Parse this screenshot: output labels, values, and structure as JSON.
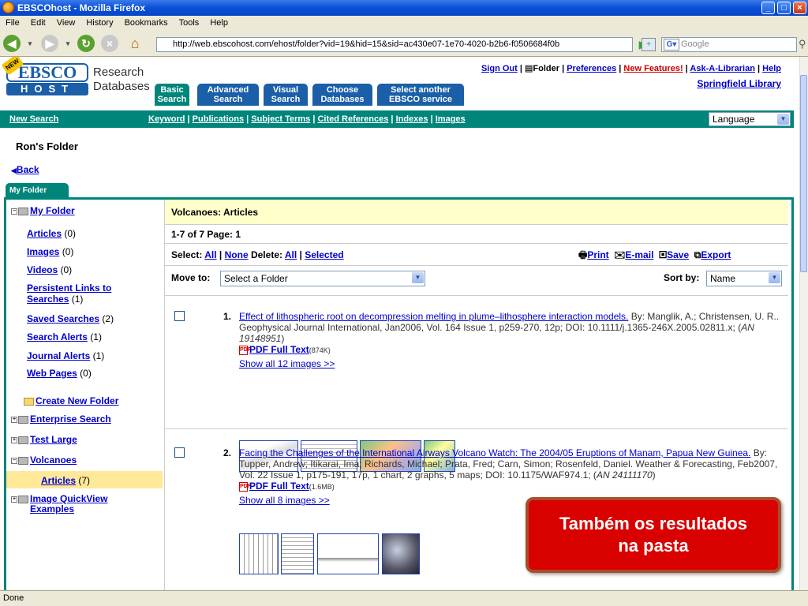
{
  "window": {
    "title": "EBSCOhost - Mozilla Firefox"
  },
  "menu": [
    "File",
    "Edit",
    "View",
    "History",
    "Bookmarks",
    "Tools",
    "Help"
  ],
  "address": {
    "url": "http://web.ebscohost.com/ehost/folder?vid=19&hid=15&sid=ac430e07-1e70-4020-b2b6-f0506684f0b",
    "search_placeholder": "Google"
  },
  "status": "Done",
  "ebsco": {
    "logo_top": "EBSCO",
    "logo_bottom": "HOST",
    "logo_badge": "NEW",
    "research": "Research",
    "databases": "Databases",
    "tabs": [
      {
        "l1": "Basic",
        "l2": "Search"
      },
      {
        "l1": "Advanced",
        "l2": "Search"
      },
      {
        "l1": "Visual",
        "l2": "Search"
      },
      {
        "l1": "Choose",
        "l2": "Databases"
      },
      {
        "l1": "Select another",
        "l2": "EBSCO service"
      }
    ],
    "toplinks": {
      "signout": "Sign Out",
      "folder": "Folder",
      "preferences": "Preferences",
      "new_features": "New Features!",
      "ask": "Ask-A-Librarian",
      "help": "Help"
    },
    "library": "Springfield Library",
    "secnav": {
      "new_search": "New Search",
      "keyword": "Keyword",
      "publications": "Publications",
      "subject_terms": "Subject Terms",
      "cited_refs": "Cited References",
      "indexes": "Indexes",
      "images": "Images"
    },
    "language": "Language"
  },
  "folder": {
    "title": "Ron's Folder",
    "back": "Back",
    "tab": "My Folder",
    "tree": {
      "my_folder": "My Folder",
      "articles": "Articles",
      "articles_count": "(0)",
      "images": "Images",
      "images_count": "(0)",
      "videos": "Videos",
      "videos_count": "(0)",
      "persistent": "Persistent Links to",
      "persistent2": "Searches",
      "persistent_count": "(1)",
      "saved": "Saved Searches",
      "saved_count": "(2)",
      "search_alerts": "Search Alerts",
      "search_alerts_count": "(1)",
      "journal_alerts": "Journal Alerts",
      "journal_alerts_count": "(1)",
      "web_pages": "Web Pages",
      "web_pages_count": "(0)",
      "create": "Create New Folder",
      "enterprise": "Enterprise Search",
      "test_large": "Test Large",
      "volcanoes": "Volcanoes",
      "vol_articles": "Articles",
      "vol_articles_count": "(7)",
      "image_quickview": "Image QuickView",
      "image_quickview2": "Examples"
    }
  },
  "results": {
    "heading": "Volcanoes: Articles",
    "count": "1-7 of 7  Page: 1",
    "select_label": "Select:",
    "all": "All",
    "none": "None",
    "delete_label": "Delete:",
    "del_all": "All",
    "del_selected": "Selected",
    "print": "Print",
    "email": "E-mail",
    "save": "Save",
    "export": "Export",
    "move_to": "Move to:",
    "move_value": "Select a Folder",
    "sort_by": "Sort by:",
    "sort_value": "Name",
    "items": [
      {
        "num": "1.",
        "title": "Effect of lithospheric root on decompression melting in plume–lithosphere interaction models.",
        "details1": " By: Manglik, A.; Christensen, U. R.. Geophysical Journal International, Jan2006, Vol. 164 Issue 1, p259-270, 12p; DOI: 10.1111/j.1365-246X.2005.02811.x; (",
        "an": "AN 19148951",
        "pdf": "PDF Full Text",
        "size": "(874K)",
        "show_images": "Show all 12 images >>"
      },
      {
        "num": "2.",
        "title": "Facing the Challenges of the International Airways Volcano Watch: The 2004/05 Eruptions of Manam, Papua New Guinea.",
        "details1": " By: Tupper, Andrew; Itikarai, Ima; Richards, Michael; Prata, Fred; Carn, Simon; Rosenfeld, Daniel. Weather & Forecasting, Feb2007, Vol. 22 Issue 1, p175-191, 17p, 1 chart, 2 graphs, 5 maps; DOI: 10.1175/WAF974.1; (",
        "an": "AN 24111170",
        "pdf": "PDF Full Text",
        "size": "(1.6MB)",
        "show_images": "Show all 8 images >>"
      }
    ]
  },
  "callout": {
    "line1": "Também os resultados",
    "line2": "na pasta"
  }
}
